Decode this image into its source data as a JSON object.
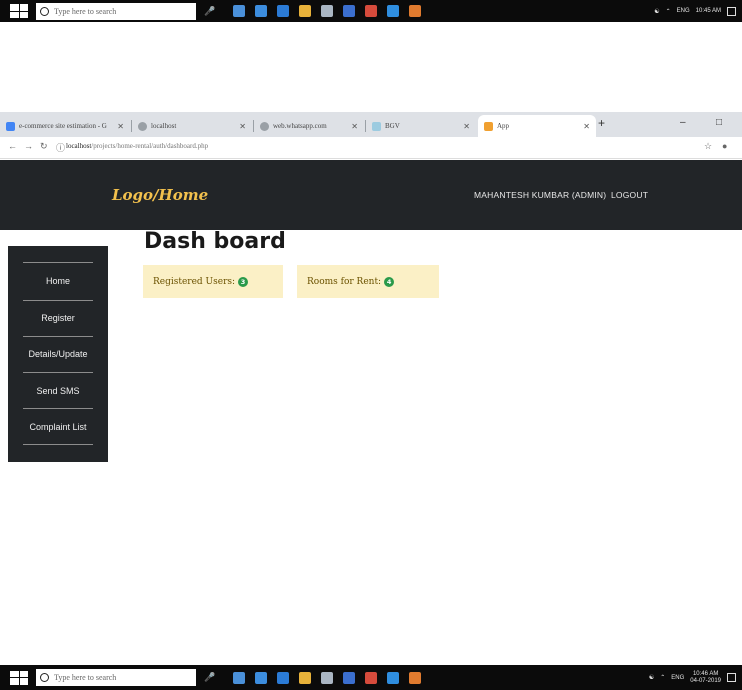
{
  "taskbar": {
    "search_placeholder": "Type here to search",
    "lang": "ENG",
    "top_time": "10:45 AM",
    "bottom_time": "10:46 AM",
    "bottom_date": "04-07-2019"
  },
  "browser": {
    "tabs": [
      {
        "label": "e-commerce site estimation - G"
      },
      {
        "label": "localhost"
      },
      {
        "label": "web.whatsapp.com"
      },
      {
        "label": "BGV"
      },
      {
        "label": "App"
      }
    ],
    "url_host": "localhost",
    "url_path": "/projects/home-rental/auth/dashboard.php"
  },
  "navbar": {
    "logo": "Logo/Home",
    "user": "MAHANTESH KUMBAR (ADMIN)",
    "logout": "LOGOUT"
  },
  "sidebar": {
    "items": [
      "Home",
      "Register",
      "Details/Update",
      "Send SMS",
      "Complaint List"
    ]
  },
  "main": {
    "title": "Dash board",
    "cards": [
      {
        "label": "Registered Users:",
        "count": "3"
      },
      {
        "label": "Rooms for Rent:",
        "count": "4"
      }
    ]
  },
  "colors": {
    "navbar": "#222528",
    "logo": "#f3c14d",
    "card": "#fbf0c6",
    "badge": "#2a9a4a"
  }
}
